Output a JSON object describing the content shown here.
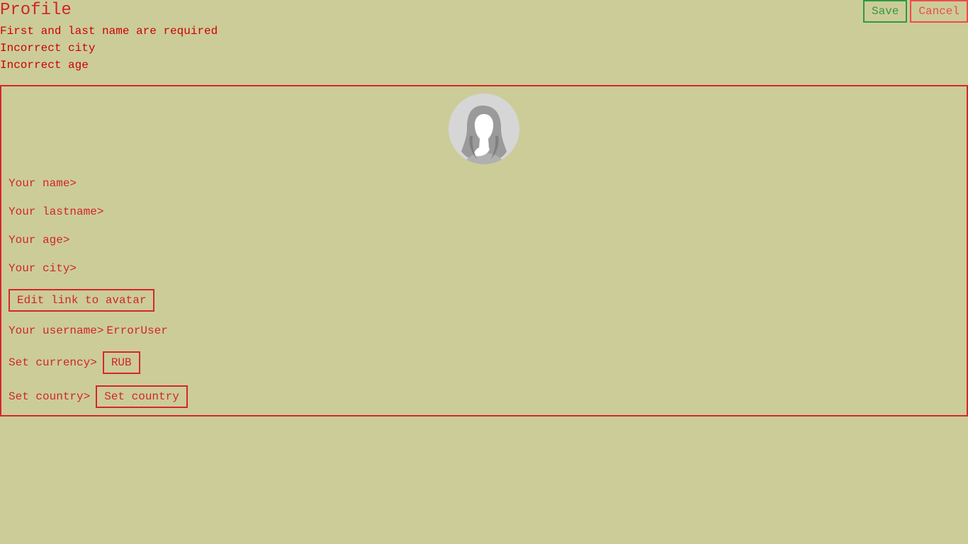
{
  "header": {
    "title": "Profile",
    "save_label": "Save",
    "cancel_label": "Cancel"
  },
  "errors": [
    "First and last name are required",
    "Incorrect city",
    "Incorrect age"
  ],
  "profile": {
    "avatar_icon": "female-silhouette-avatar",
    "name_label": "Your name>",
    "lastname_label": "Your lastname>",
    "age_label": "Your age>",
    "city_label": "Your city>",
    "edit_avatar_label": "Edit link to avatar",
    "username_label": "Your username>",
    "username_value": "ErrorUser",
    "currency_label": "Set currency>",
    "currency_value": "RUB",
    "country_label": "Set country>",
    "country_button_label": "Set country"
  },
  "colors": {
    "background": "#cccc99",
    "accent_red": "#d62828",
    "error_red": "#cc0000",
    "save_green": "#2f9b3c",
    "cancel_red": "#ee4b4b"
  }
}
